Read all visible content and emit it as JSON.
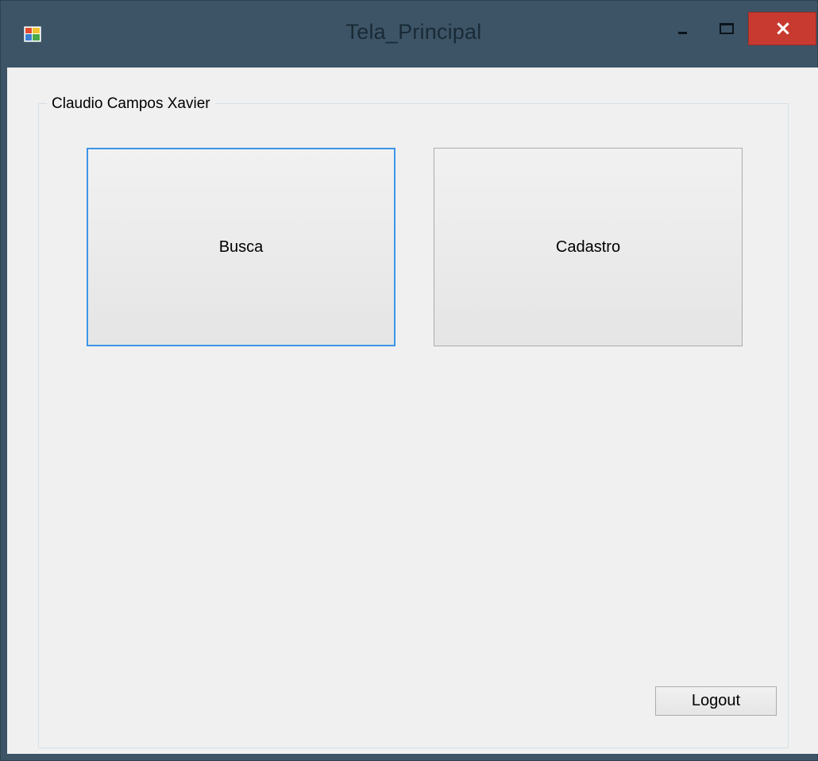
{
  "window": {
    "title": "Tela_Principal",
    "controls": {
      "minimize_icon": "minimize-icon",
      "maximize_icon": "maximize-icon",
      "close_label": "×"
    }
  },
  "group": {
    "label": "Claudio Campos Xavier"
  },
  "buttons": {
    "busca": "Busca",
    "cadastro": "Cadastro",
    "logout": "Logout"
  },
  "colors": {
    "frame": "#3c5466",
    "client": "#f0f0f0",
    "close": "#c83a30",
    "focus": "#3c95e8"
  }
}
